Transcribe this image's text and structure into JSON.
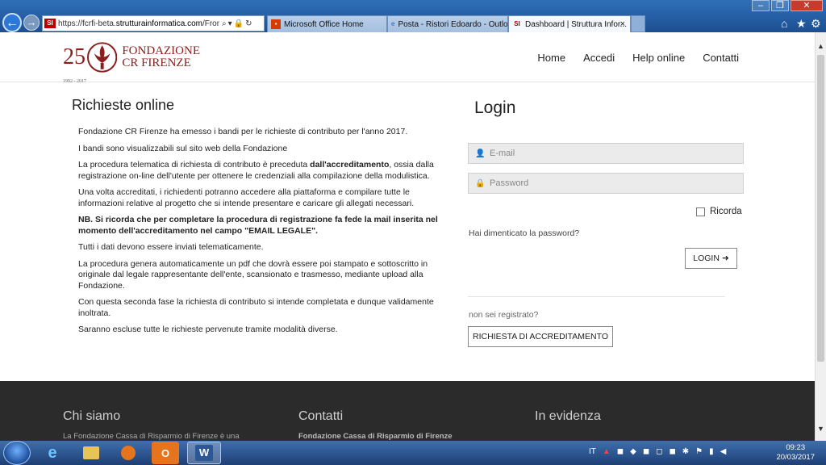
{
  "browser": {
    "url_prefix": "https://fcrfi-beta.",
    "url_host": "strutturainformatica.com",
    "url_suffix": "/Fronter",
    "favicon": "SI",
    "tabs": [
      {
        "label": "Microsoft Office Home"
      },
      {
        "label": "Posta - Ristori Edoardo - Outlo..."
      },
      {
        "label": "Dashboard | Struttura Infor...",
        "favicon": "SI"
      }
    ],
    "close_glyph": "×"
  },
  "site": {
    "logo": {
      "number": "25",
      "years": "1992 - 2017",
      "line1": "FONDAZIONE",
      "line2": "CR FIRENZE"
    },
    "nav": [
      "Home",
      "Accedi",
      "Help online",
      "Contatti"
    ]
  },
  "left": {
    "title": "Richieste online",
    "paragraphs": {
      "p1": "Fondazione CR Firenze ha emesso i bandi per le richieste di contributo per l'anno 2017.",
      "p2": "I bandi sono visualizzabili sul sito web della Fondazione",
      "p3a": "La procedura telematica di richiesta di contributo è preceduta ",
      "p3b": "dall'accreditamento",
      "p3c": ", ossia dalla registrazione on-line dell'utente per ottenere le credenziali alla compilazione della modulistica.",
      "p4": "Una volta accreditati, i richiedenti potranno accedere alla piattaforma e compilare tutte le informazioni relative al progetto che si intende presentare e caricare gli allegati necessari.",
      "p5": "NB. Si ricorda che per completare  la procedura di registrazione fa fede la mail inserita nel momento dell'accreditamento nel campo \"EMAIL LEGALE\".",
      "p6": "Tutti i dati devono essere inviati telematicamente.",
      "p7": "La procedura genera automaticamente un pdf che dovrà essere poi stampato e sottoscritto in originale dal legale rappresentante dell'ente, scansionato e trasmesso, mediante upload  alla Fondazione.",
      "p8": "Con questa seconda fase la richiesta di contributo si intende completata e dunque validamente inoltrata.",
      "p9": "Saranno escluse tutte le richieste pervenute tramite modalità diverse."
    }
  },
  "login": {
    "title": "Login",
    "email_placeholder": "E-mail",
    "password_placeholder": "Password",
    "remember_label": "Ricorda",
    "forgot_label": "Hai dimenticato la password?",
    "login_button": "LOGIN",
    "not_registered": "non sei registrato?",
    "accreditation_button": "RICHIESTA DI ACCREDITAMENTO"
  },
  "footer": {
    "col1_title": "Chi siamo",
    "col1_text": "La Fondazione Cassa di Risparmio di Firenze è una",
    "col2_title": "Contatti",
    "col2_text": "Fondazione Cassa di Risparmio di Firenze",
    "col3_title": "In evidenza"
  },
  "taskbar": {
    "lang": "IT",
    "time": "09:23",
    "date": "20/03/2017",
    "word_label": "W",
    "outlook_label": "O"
  },
  "colors": {
    "brand": "#8a1e1e",
    "footer_bg": "#2b2b2b",
    "field_bg": "#ebebeb"
  }
}
